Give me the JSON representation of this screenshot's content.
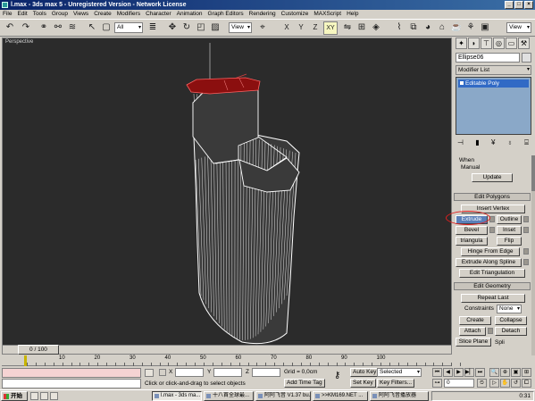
{
  "window": {
    "title": "l.max - 3ds max 5 - Unregistered Version - Network License"
  },
  "menu": [
    "File",
    "Edit",
    "Tools",
    "Group",
    "Views",
    "Create",
    "Modifiers",
    "Character",
    "Animation",
    "Graph Editors",
    "Rendering",
    "Customize",
    "MAXScript",
    "Help"
  ],
  "toolbar": {
    "selection_filter": "All",
    "ref_coord": "View",
    "ref_coord2": "View",
    "axis_active": "XY",
    "axis_x": "X",
    "axis_y": "Y",
    "axis_z": "Z"
  },
  "viewport": {
    "label": "Perspective"
  },
  "command_panel": {
    "object_name": "Ellipse06",
    "modifier_list": "Modifier List",
    "stack_item": "Editable Poly",
    "when_label": "When",
    "manual_label": "Manual",
    "update_btn": "Update",
    "edit_polygons_head": "Edit Polygons",
    "insert_vertex": "Insert Vertex",
    "extrude": "Extrude",
    "outline": "Outline",
    "bevel": "Bevel",
    "inset": "Inset",
    "triangulate": "triangula",
    "flip": "Flip",
    "hinge": "Hinge From Edge",
    "extrude_spline": "Extrude Along Spline",
    "edit_triangulation": "Edit Triangulation",
    "edit_geometry_head": "Edit Geometry",
    "repeat_last": "Repeat Last",
    "constraints_label": "Constraints",
    "constraints_value": "None",
    "create": "Create",
    "collapse": "Collapse",
    "attach": "Attach",
    "detach": "Detach",
    "slice_plane": "Slice Plane",
    "split": "Spli"
  },
  "timeline": {
    "frame_display": "0 / 100",
    "ticks": [
      "10",
      "20",
      "30",
      "40",
      "50",
      "60",
      "70",
      "80",
      "90",
      "100"
    ]
  },
  "status": {
    "x_label": "X",
    "y_label": "Y",
    "z_label": "Z",
    "grid": "Grid = 0,0cm",
    "prompt": "Click or click-and-drag to select objects",
    "add_time_tag": "Add Time Tag",
    "auto_key": "Auto Key",
    "selected": "Selected",
    "set_key": "Set Key",
    "key_filters": "Key Filters...",
    "frame": "0"
  },
  "taskbar": {
    "start": "开始",
    "tasks": [
      "l.max - 3ds ma...",
      "十八首全球最...",
      "阿阿飞音 V1.37 bu...",
      ">>KM169.NET ...",
      "阿阿飞音播放器"
    ],
    "clock": "0:31"
  }
}
